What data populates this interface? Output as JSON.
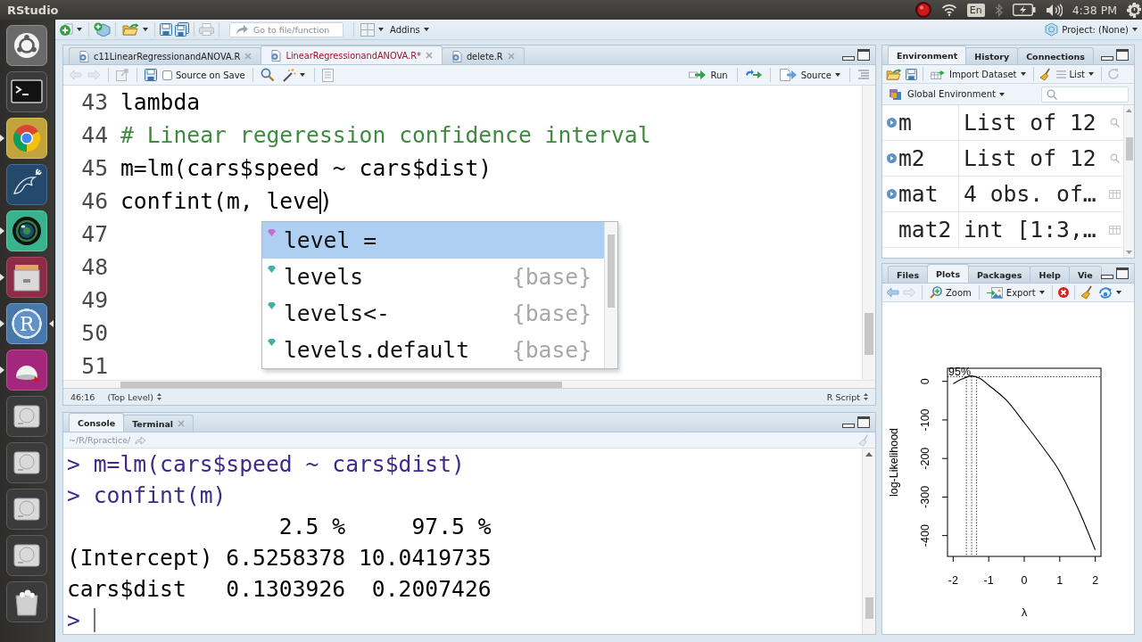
{
  "top_bar": {
    "title": "RStudio",
    "keyboard_layout": "En",
    "clock": "4:38 PM"
  },
  "launcher": [
    {
      "kind": "dash",
      "running": false,
      "focused": false
    },
    {
      "kind": "terminal",
      "running": false,
      "focused": false
    },
    {
      "kind": "browser",
      "running": true,
      "focused": false
    },
    {
      "kind": "dolphin",
      "running": false,
      "focused": false
    },
    {
      "kind": "lens",
      "running": true,
      "focused": false
    },
    {
      "kind": "cabinet",
      "running": true,
      "focused": false
    },
    {
      "kind": "letter",
      "label": "R",
      "running": true,
      "focused": true
    },
    {
      "kind": "dome",
      "running": true,
      "focused": false
    },
    {
      "kind": "drive",
      "running": false,
      "focused": false
    },
    {
      "kind": "drive",
      "running": false,
      "focused": false
    },
    {
      "kind": "drive",
      "running": false,
      "focused": false
    },
    {
      "kind": "drive",
      "running": false,
      "focused": false
    },
    {
      "kind": "trash",
      "running": false,
      "focused": false
    }
  ],
  "toolbar": {
    "goto_field": {
      "placeholder": "Go to file/function"
    },
    "addins": "Addins",
    "project": "Project: (None)"
  },
  "editor": {
    "tabs": [
      {
        "label": "c11LinearRegressionandANOVA.R",
        "selected": false,
        "modified": false
      },
      {
        "label": "LinearRegressionandANOVA.R*",
        "selected": true,
        "modified": true
      },
      {
        "label": "delete.R",
        "selected": false,
        "modified": false
      }
    ],
    "toolbar": {
      "nav": [
        {
          "disabled": true
        },
        {
          "disabled": true
        }
      ],
      "source_on_save": {
        "label": "Source on Save",
        "checked": false
      },
      "run": "Run",
      "source": "Source"
    },
    "lines": [
      {
        "number": "43",
        "kind": "code",
        "text": "lambda",
        "cursor": false
      },
      {
        "number": "44",
        "kind": "comment",
        "text": "# Linear regeression confidence interval",
        "cursor": false
      },
      {
        "number": "45",
        "kind": "code",
        "text": "m=lm(cars$speed ~ cars$dist)",
        "cursor": false
      },
      {
        "number": "46",
        "kind": "code",
        "text": "confint(m, leve",
        "after_cursor": ")",
        "cursor": true
      },
      {
        "number": "47",
        "cursor": false
      },
      {
        "number": "48",
        "cursor": false
      },
      {
        "number": "49",
        "cursor": false
      },
      {
        "number": "50",
        "cursor": false
      },
      {
        "number": "51",
        "cursor": false
      }
    ],
    "autocomplete": [
      {
        "kind": "argument",
        "label": "level =",
        "selected": true
      },
      {
        "kind": "function",
        "label": "levels",
        "package": "{base}",
        "selected": false
      },
      {
        "kind": "function",
        "label": "levels<-",
        "package": "{base}",
        "selected": false
      },
      {
        "kind": "function",
        "label": "levels.default",
        "package": "{base}",
        "selected": false
      }
    ],
    "status_bar": {
      "position": "46:16",
      "scope": "(Top Level)",
      "file_type": "R Script"
    }
  },
  "console": {
    "tabs": [
      {
        "label": "Console",
        "selected": true,
        "closable": false
      },
      {
        "label": "Terminal",
        "selected": false,
        "closable": true
      }
    ],
    "path": "~/R/Rpractice/",
    "lines": [
      {
        "kind": "input",
        "text": "> m=lm(cars$speed ~ cars$dist)",
        "cursor": false
      },
      {
        "kind": "input",
        "text": "> confint(m)",
        "cursor": false
      },
      {
        "kind": "output",
        "text": "                2.5 %     97.5 %",
        "cursor": false
      },
      {
        "kind": "output",
        "text": "(Intercept) 6.5258378 10.0419735",
        "cursor": false
      },
      {
        "kind": "output",
        "text": "cars$dist   0.1303926  0.2007426",
        "cursor": false
      },
      {
        "kind": "input",
        "text": ">",
        "cursor": true
      }
    ]
  },
  "environment": {
    "tabs": [
      {
        "label": "Environment",
        "selected": true
      },
      {
        "label": "History",
        "selected": false
      },
      {
        "label": "Connections",
        "selected": false
      }
    ],
    "import": "Import Dataset",
    "view": "List",
    "scope": "Global Environment",
    "rows": [
      {
        "kind": "list",
        "name": "m",
        "value": "List of 12",
        "expandable": true
      },
      {
        "kind": "list",
        "name": "m2",
        "value": "List of 12",
        "expandable": true
      },
      {
        "kind": "grid",
        "name": "mat",
        "value": "4 obs. of…",
        "expandable": true
      },
      {
        "kind": "grid",
        "name": "mat2",
        "value": "int [1:3,…",
        "expandable": false
      }
    ]
  },
  "plots": {
    "tabs": [
      {
        "label": "Files",
        "selected": false
      },
      {
        "label": "Plots",
        "selected": true
      },
      {
        "label": "Packages",
        "selected": false
      },
      {
        "label": "Help",
        "selected": false
      },
      {
        "label": "Vie",
        "selected": false
      }
    ],
    "nav": [
      {
        "disabled": false
      },
      {
        "disabled": true
      }
    ],
    "zoom": "Zoom",
    "export": "Export",
    "chart_data": [
      {
        "type": "line",
        "xlabel": "λ",
        "ylabel": "log-Likelihood",
        "x": [
          -2,
          -1.75,
          -1.5,
          -1.25,
          -1,
          -0.5,
          0,
          0.5,
          1,
          1.5,
          2
        ],
        "values": [
          -6,
          6,
          14,
          8,
          -10,
          -49,
          -107,
          -168,
          -234,
          -327,
          -437
        ],
        "color": "#000000",
        "xlim": [
          -2.16,
          2.16
        ],
        "ylim": [
          -454,
          34
        ],
        "xticks": [
          -2,
          -1,
          0,
          1,
          2
        ],
        "yticks": [
          0,
          -100,
          -200,
          -300,
          -400
        ],
        "ref_lines": [
          {
            "axis": "y",
            "value": 12,
            "line_style": "dotted"
          },
          {
            "axis": "x",
            "value": -1.63,
            "line_style": "dotted"
          },
          {
            "axis": "x",
            "value": -1.48,
            "line_style": "dotted"
          },
          {
            "axis": "x",
            "value": -1.34,
            "line_style": "dotted"
          }
        ],
        "annotations": [
          "95%"
        ]
      }
    ]
  }
}
